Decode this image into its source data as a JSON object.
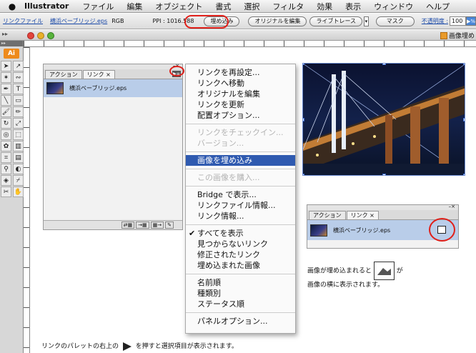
{
  "menubar": {
    "apple": "",
    "app": "Illustrator",
    "items": [
      "ファイル",
      "編集",
      "オブジェクト",
      "書式",
      "選択",
      "フィルタ",
      "効果",
      "表示",
      "ウィンドウ",
      "ヘルプ"
    ]
  },
  "controlbar": {
    "link_file": "リンクファイル",
    "file_name": "横浜ベーブリッジ.eps",
    "color_mode": "RGB",
    "ppi": "PPI : 1016.588",
    "embed_button": "埋め込み",
    "edit_original_button": "オリジナルを編集",
    "live_trace_button": "ライブトレース",
    "mask_button": "マスク",
    "opacity_label": "不透明度 :",
    "opacity_value": "100",
    "opacity_button": "▶%",
    "highlight_color": "#e0201a"
  },
  "document": {
    "tab_title": "画像埋め"
  },
  "toolbox": {
    "app_badge": "Ai",
    "tools": [
      "arrow-icon",
      "direct-select-icon",
      "magic-wand-icon",
      "lasso-icon",
      "pen-icon",
      "type-icon",
      "line-icon",
      "rect-icon",
      "paintbrush-icon",
      "pencil-icon",
      "rotate-icon",
      "scale-icon",
      "warp-icon",
      "free-transform-icon",
      "symbol-icon",
      "graph-icon",
      "mesh-icon",
      "gradient-icon",
      "eyedropper-icon",
      "blend-icon",
      "live-paint-icon",
      "slice-icon",
      "scissors-icon",
      "hand-icon"
    ]
  },
  "links_palette_left": {
    "tab_actions": "アクション",
    "tab_links": "リンク ×",
    "file_name": "横浜ベーブリッジ.eps",
    "close_glyph": "–×",
    "menu_glyph": "▶≡",
    "bottom_buttons": [
      "⇄▦",
      "→▦",
      "▦→",
      "✎"
    ]
  },
  "flyout_menu": {
    "items": [
      {
        "label": "リンクを再設定...",
        "state": "normal"
      },
      {
        "label": "リンクへ移動",
        "state": "normal"
      },
      {
        "label": "オリジナルを編集",
        "state": "normal"
      },
      {
        "label": "リンクを更新",
        "state": "normal"
      },
      {
        "label": "配置オプション...",
        "state": "normal"
      },
      {
        "label": "リンクをチェックイン...",
        "state": "disabled"
      },
      {
        "label": "バージョン...",
        "state": "disabled"
      },
      {
        "label": "画像を埋め込み",
        "state": "highlighted"
      },
      {
        "label": "この画像を購入...",
        "state": "disabled"
      },
      {
        "label": "Bridge で表示...",
        "state": "normal"
      },
      {
        "label": "リンクファイル情報...",
        "state": "normal"
      },
      {
        "label": "リンク情報...",
        "state": "normal"
      },
      {
        "label": "すべてを表示",
        "state": "checked"
      },
      {
        "label": "見つからないリンク",
        "state": "normal"
      },
      {
        "label": "修正されたリンク",
        "state": "normal"
      },
      {
        "label": "埋め込まれた画像",
        "state": "normal"
      },
      {
        "label": "名前順",
        "state": "normal"
      },
      {
        "label": "種類別",
        "state": "normal"
      },
      {
        "label": "ステータス順",
        "state": "normal"
      },
      {
        "label": "パネルオプション...",
        "state": "normal"
      }
    ],
    "checkmark": "✔"
  },
  "links_palette_right": {
    "tab_actions": "アクション",
    "tab_links": "リンク ×",
    "file_name": "横浜ベーブリッジ.eps",
    "close_glyph": "–×"
  },
  "notes": {
    "embed_note_line1_a": "画像が埋め込まれると",
    "embed_note_line1_b": "が",
    "embed_note_line2": "画像の横に表示されます。",
    "bottom_note_a": "リンクのパレットの右上の",
    "bottom_note_b": "を押すと選択項目が表示されます。"
  }
}
